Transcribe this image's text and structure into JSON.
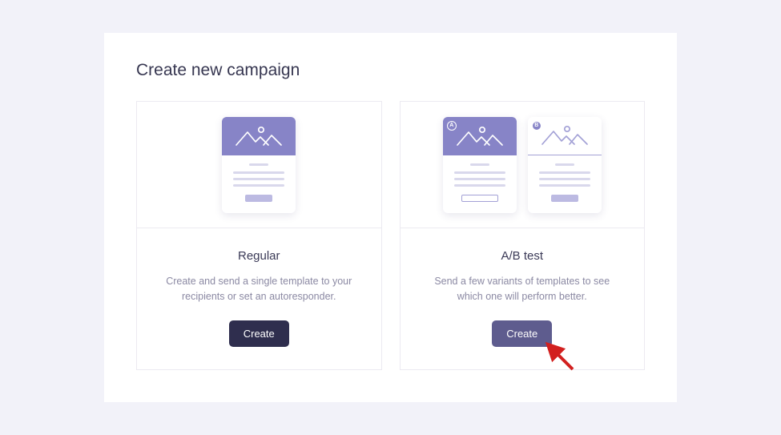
{
  "page": {
    "title": "Create new campaign"
  },
  "cards": {
    "regular": {
      "title": "Regular",
      "description": "Create and send a single template to your recipients or set an autoresponder.",
      "button": "Create"
    },
    "abtest": {
      "title": "A/B test",
      "description": "Send a few variants of templates to see which one will perform better.",
      "button": "Create",
      "badge_a": "A",
      "badge_b": "B"
    }
  }
}
